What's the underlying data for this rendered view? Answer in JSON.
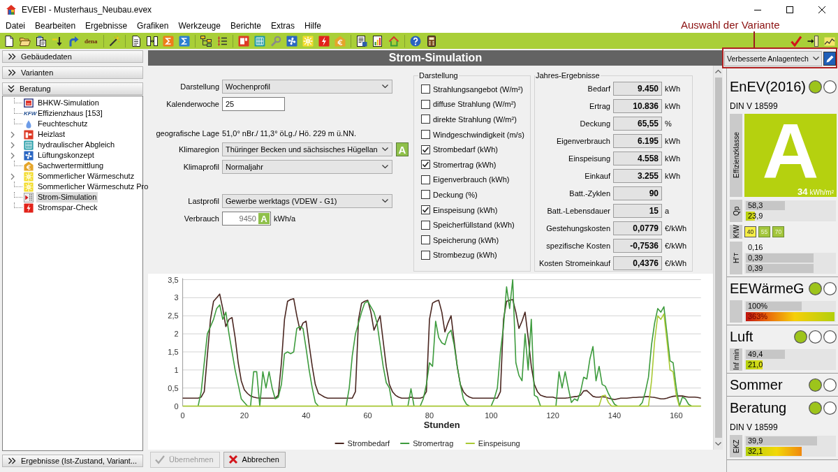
{
  "window": {
    "title": "EVEBI - Musterhaus_Neubau.evex"
  },
  "annotation": {
    "label": "Auswahl der Variante"
  },
  "menu": [
    "Datei",
    "Bearbeiten",
    "Ergebnisse",
    "Grafiken",
    "Werkzeuge",
    "Berichte",
    "Extras",
    "Hilfe"
  ],
  "toolbar": {
    "text_button": "dena"
  },
  "sidebar": {
    "sections": [
      {
        "label": "Gebäudedaten",
        "expanded": false
      },
      {
        "label": "Varianten",
        "expanded": false
      },
      {
        "label": "Beratung",
        "expanded": true,
        "items": [
          {
            "label": "BHKW-Simulation",
            "expandable": false,
            "selected": false
          },
          {
            "label": "Effizienzhaus [153]",
            "logo": "KFW",
            "expandable": false,
            "selected": false
          },
          {
            "label": "Feuchteschutz",
            "expandable": false,
            "selected": false
          },
          {
            "label": "Heizlast",
            "expandable": true,
            "selected": false
          },
          {
            "label": "hydraulischer Abgleich",
            "expandable": true,
            "selected": false
          },
          {
            "label": "Lüftungskonzept",
            "expandable": true,
            "selected": false
          },
          {
            "label": "Sachwertermittlung",
            "expandable": false,
            "selected": false
          },
          {
            "label": "Sommerlicher Wärmeschutz",
            "expandable": true,
            "selected": false
          },
          {
            "label": "Sommerlicher Wärmeschutz Pro",
            "expandable": false,
            "selected": false
          },
          {
            "label": "Strom-Simulation",
            "expandable": false,
            "selected": true
          },
          {
            "label": "Stromspar-Check",
            "expandable": false,
            "selected": false
          }
        ]
      },
      {
        "label": "Ergebnisse (Ist-Zustand, Variant...",
        "expanded": false
      }
    ]
  },
  "panel": {
    "title": "Strom-Simulation",
    "form": [
      [
        {
          "kind": "dropdown",
          "label": "Darstellung",
          "value": "Wochenprofil",
          "disabled": false
        },
        {
          "kind": "input",
          "label": "Kalenderwoche",
          "value": "25",
          "disabled": false
        }
      ],
      [
        {
          "kind": "text",
          "label": "geografische Lage",
          "value": "51,0° nBr./ 11,3° öLg./ Hö. 229 m ü.NN."
        },
        {
          "kind": "dropdown",
          "label": "Klimaregion",
          "value": "Thüringer Becken und sächsisches Hügellan",
          "button": "A",
          "disabled": false
        },
        {
          "kind": "dropdown",
          "label": "Klimaprofil",
          "value": "Normaljahr",
          "disabled": false
        }
      ],
      [
        {
          "kind": "dropdown",
          "label": "Lastprofil",
          "value": "Gewerbe werktags (VDEW - G1)",
          "disabled": false
        },
        {
          "kind": "input",
          "label": "Verbrauch",
          "value": "9450",
          "button": "A",
          "unit": "kWh/a",
          "disabled": true
        }
      ]
    ],
    "display_options": {
      "title": "Darstellung",
      "items": [
        {
          "label": "Strahlungsangebot (W/m²)",
          "checked": false
        },
        {
          "label": "diffuse Strahlung (W/m²)",
          "checked": false
        },
        {
          "label": "direkte Strahlung (W/m²)",
          "checked": false
        },
        {
          "label": "Windgeschwindigkeit (m/s)",
          "checked": false
        },
        {
          "label": "Strombedarf (kWh)",
          "checked": true
        },
        {
          "label": "Stromertrag (kWh)",
          "checked": true
        },
        {
          "label": "Eigenverbrauch (kWh)",
          "checked": false
        },
        {
          "label": "Deckung (%)",
          "checked": false
        },
        {
          "label": "Einspeisung (kWh)",
          "checked": true
        },
        {
          "label": "Speicherfüllstand (kWh)",
          "checked": false
        },
        {
          "label": "Speicherung (kWh)",
          "checked": false
        },
        {
          "label": "Strombezug (kWh)",
          "checked": false
        }
      ]
    },
    "results": {
      "title": "Jahres-Ergebnisse",
      "rows": [
        {
          "label": "Bedarf",
          "value": "9.450",
          "unit": "kWh"
        },
        {
          "label": "Ertrag",
          "value": "10.836",
          "unit": "kWh"
        },
        {
          "label": "Deckung",
          "value": "65,55",
          "unit": "%"
        },
        {
          "label": "Eigenverbrauch",
          "value": "6.195",
          "unit": "kWh"
        },
        {
          "label": "Einspeisung",
          "value": "4.558",
          "unit": "kWh"
        },
        {
          "label": "Einkauf",
          "value": "3.255",
          "unit": "kWh"
        },
        {
          "label": "Batt.-Zyklen",
          "value": "90"
        },
        {
          "label": "Batt.-Lebensdauer",
          "value": "15",
          "unit": "a"
        },
        {
          "label": "Gestehungskosten",
          "value": "0,0779",
          "unit": "€/kWh"
        },
        {
          "label": "spezifische Kosten",
          "value": "-0,7536",
          "unit": "€/kWh"
        },
        {
          "label": "Kosten Stromeinkauf",
          "value": "0,4376",
          "unit": "€/kWh"
        }
      ]
    },
    "chart_data": {
      "type": "line",
      "xlabel": "Stunden",
      "grid": true,
      "legend": true,
      "xlim": [
        0,
        168
      ],
      "ylim": [
        0,
        3.5
      ],
      "xticks": [
        0,
        20,
        40,
        60,
        80,
        100,
        120,
        140,
        160
      ],
      "yticks": [
        0,
        {
          "value": 0.5,
          "label": "0,5"
        },
        1,
        {
          "value": 1.5,
          "label": "1,5"
        },
        2,
        {
          "value": 2.5,
          "label": "2,5"
        },
        3,
        {
          "value": 3.5,
          "label": "3,5"
        }
      ],
      "x": [
        0,
        1,
        2,
        3,
        4,
        5,
        6,
        7,
        8,
        9,
        10,
        11,
        12,
        13,
        14,
        15,
        16,
        17,
        18,
        19,
        20,
        21,
        22,
        23,
        24,
        25,
        26,
        27,
        28,
        29,
        30,
        31,
        32,
        33,
        34,
        35,
        36,
        37,
        38,
        39,
        40,
        41,
        42,
        43,
        44,
        45,
        46,
        47,
        48,
        49,
        50,
        51,
        52,
        53,
        54,
        55,
        56,
        57,
        58,
        59,
        60,
        61,
        62,
        63,
        64,
        65,
        66,
        67,
        68,
        69,
        70,
        71,
        72,
        73,
        74,
        75,
        76,
        77,
        78,
        79,
        80,
        81,
        82,
        83,
        84,
        85,
        86,
        87,
        88,
        89,
        90,
        91,
        92,
        93,
        94,
        95,
        96,
        97,
        98,
        99,
        100,
        101,
        102,
        103,
        104,
        105,
        106,
        107,
        108,
        109,
        110,
        111,
        112,
        113,
        114,
        115,
        116,
        117,
        118,
        119,
        120,
        121,
        122,
        123,
        124,
        125,
        126,
        127,
        128,
        129,
        130,
        131,
        132,
        133,
        134,
        135,
        136,
        137,
        138,
        139,
        140,
        141,
        142,
        143,
        144,
        145,
        146,
        147,
        148,
        149,
        150,
        151,
        152,
        153,
        154,
        155,
        156,
        157,
        158,
        159,
        160,
        161,
        162,
        163,
        164,
        165,
        166,
        167,
        168
      ],
      "series": [
        {
          "name": "Strombedarf",
          "color": "#4a2620",
          "values": [
            0.22,
            0.22,
            0.22,
            0.22,
            0.22,
            0.22,
            0.25,
            0.4,
            1.4,
            2.4,
            2.9,
            3.0,
            3.1,
            2.7,
            2.2,
            2.4,
            2.45,
            1.9,
            1.2,
            0.7,
            0.45,
            0.35,
            0.28,
            0.25,
            0.23,
            0.22,
            0.22,
            0.22,
            0.22,
            0.22,
            0.22,
            0.3,
            1.2,
            2.4,
            2.9,
            2.95,
            2.97,
            2.5,
            2.1,
            2.3,
            2.35,
            1.7,
            1.1,
            0.6,
            0.35,
            0.3,
            0.25,
            0.22,
            0.22,
            0.22,
            0.22,
            0.22,
            0.22,
            0.22,
            0.22,
            0.22,
            0.4,
            2.4,
            2.85,
            2.9,
            2.93,
            2.6,
            2.1,
            2.3,
            2.5,
            1.8,
            1.1,
            0.6,
            0.4,
            0.3,
            0.25,
            0.22,
            0.22,
            0.22,
            0.25,
            0.22,
            0.22,
            0.22,
            0.25,
            0.4,
            2.4,
            2.85,
            2.9,
            2.93,
            2.6,
            2.05,
            2.3,
            2.5,
            1.8,
            1.1,
            0.6,
            0.4,
            0.3,
            0.25,
            0.22,
            0.22,
            0.22,
            0.22,
            0.22,
            0.22,
            0.22,
            0.22,
            0.22,
            0.4,
            2.4,
            2.9,
            2.93,
            2.95,
            2.6,
            2.15,
            2.35,
            2.6,
            1.9,
            1.1,
            0.6,
            0.4,
            0.3,
            0.27,
            0.25,
            0.25,
            0.25,
            0.22,
            0.22,
            0.22,
            0.22,
            0.23,
            0.25,
            0.26,
            0.27,
            0.3,
            0.42,
            0.43,
            0.35,
            0.27,
            0.25,
            0.25,
            0.26,
            0.25,
            0.22,
            0.2,
            0.18,
            0.2,
            0.22,
            0.22,
            0.22,
            0.23,
            0.24,
            0.24,
            0.25,
            0.25,
            0.26,
            0.26,
            0.25,
            0.24,
            0.22,
            0.2,
            0.2,
            0.22,
            0.25,
            0.27,
            0.28,
            0.28,
            0.28,
            0.26,
            0.25,
            0.25,
            0.25,
            0.24,
            0.22
          ]
        },
        {
          "name": "Stromertrag",
          "color": "#3d9b3d",
          "values": [
            null,
            null,
            null,
            null,
            null,
            0,
            0.4,
            1.2,
            2.0,
            2.2,
            2.4,
            2.7,
            2.8,
            2.4,
            2.6,
            2.0,
            1.5,
            1.0,
            0.6,
            0.2,
            0.1,
            0,
            0,
            0.95,
            0.95,
            0,
            0.95,
            0.5,
            0.95,
            0.5,
            0.2,
            0.25,
            0.6,
            1.45,
            1.5,
            1.45,
            1.5,
            2.15,
            2.2,
            2.15,
            1.6,
            1.0,
            0.5,
            0.1,
            0,
            null,
            null,
            null,
            null,
            null,
            null,
            null,
            null,
            0,
            0.5,
            1.4,
            2.0,
            2.3,
            2.6,
            2.85,
            2.9,
            2.75,
            2.6,
            2.3,
            1.7,
            1.1,
            0.65,
            0.5,
            0,
            null,
            null,
            null,
            null,
            0,
            0.48,
            0,
            null,
            0,
            0.2,
            0.6,
            1.2,
            1.1,
            2.35,
            1.9,
            1.75,
            1.7,
            2.0,
            2.1,
            1.7,
            1.1,
            0.6,
            0.2,
            0.05,
            0,
            null,
            null,
            null,
            null,
            null,
            null,
            0,
            0.2,
            0.5,
            1.5,
            2.2,
            3.3,
            2.7,
            3.5,
            1.2,
            0.85,
            0.7,
            2.0,
            1.0,
            2.4,
            0.3,
            0.25,
            0,
            null,
            null,
            null,
            null,
            0,
            0.95,
            0.5,
            0.95,
            0.5,
            0.1,
            0.2,
            0.15,
            0.4,
            0.8,
            0.75,
            1.3,
            1.65,
            0.7,
            1.1,
            0.6,
            0.55,
            0.35,
            0.2,
            0.05,
            0,
            null,
            null,
            null,
            null,
            null,
            null,
            0,
            0.1,
            0.4,
            0.8,
            1.7,
            2.3,
            2.7,
            2.6,
            2.75,
            2.0,
            1.25,
            1.2,
            0.5,
            0,
            0.25,
            0.2,
            0.05,
            0,
            null,
            null,
            null
          ]
        },
        {
          "name": "Einspeisung",
          "color": "#a9c934",
          "values": [
            0,
            0,
            0,
            0,
            0,
            0,
            0,
            0,
            0,
            0,
            0,
            0,
            0,
            0,
            0,
            0,
            0,
            0,
            0,
            0,
            0,
            0,
            0,
            0,
            0,
            0,
            0,
            0,
            0,
            0,
            0,
            0,
            0,
            0,
            0,
            0,
            0,
            0,
            0,
            0,
            0,
            0,
            0,
            0,
            0,
            0,
            0,
            0,
            0,
            0,
            0,
            0,
            0,
            0,
            0,
            0,
            0,
            0,
            0,
            0,
            0,
            0,
            0,
            0,
            0,
            0,
            0,
            0,
            0,
            0,
            0,
            0,
            0,
            0,
            0,
            0,
            0,
            0,
            0,
            0,
            0,
            0,
            0,
            0,
            0,
            0,
            0,
            0,
            0,
            0,
            0,
            0,
            0,
            0,
            0,
            0,
            0,
            0,
            0,
            0,
            0,
            0,
            0,
            0,
            0,
            0,
            0,
            0,
            0,
            0,
            0,
            0,
            0,
            0,
            0,
            0,
            0,
            0,
            0,
            0,
            0,
            0,
            0,
            0,
            0,
            0,
            0,
            0,
            0,
            0,
            0,
            0,
            0,
            0,
            0,
            0,
            0.28,
            0.3,
            0.1,
            0,
            0,
            0,
            0,
            0,
            0,
            0,
            0,
            0,
            0,
            0,
            0,
            0,
            0.7,
            1.8,
            2.5,
            2.4,
            2.55,
            1.8,
            1.0,
            0.95,
            0.3,
            0,
            0,
            0,
            0,
            0,
            0,
            0,
            0
          ]
        }
      ]
    },
    "buttons": [
      {
        "kind": "apply",
        "label": "Übernehmen",
        "disabled": true
      },
      {
        "kind": "cancel",
        "label": "Abbrechen",
        "disabled": false
      }
    ]
  },
  "variant_selector": {
    "value": "Verbesserte Anlagentech"
  },
  "ratings": [
    {
      "title": "EnEV(2016)",
      "subtitle": "DIN V 18599",
      "lights": [
        {
          "on": true
        },
        {
          "on": false
        }
      ],
      "efficiency": {
        "label": "Effizienzklasse",
        "class": "A",
        "value": "34",
        "unit": "kWh/m²"
      },
      "metrics": [
        {
          "kind": "bars",
          "label": "Qp",
          "bars": [
            {
              "kind": "reference",
              "text": "58,3",
              "level": 0.44
            },
            {
              "kind": "result",
              "text": "23,9",
              "level": 0.1
            }
          ]
        },
        {
          "kind": "classes",
          "label": "KfW",
          "classes": [
            {
              "text": "40",
              "selected": true
            },
            {
              "text": "55",
              "selected": false
            },
            {
              "text": "70",
              "selected": false
            }
          ]
        },
        {
          "kind": "bars",
          "label": "H'$_{T}$",
          "bars": [
            {
              "kind": "text",
              "text": "0,16"
            },
            {
              "kind": "reference",
              "text": "0,39",
              "level": 0.76
            },
            {
              "kind": "reference",
              "text": "0,39",
              "level": 0.76
            }
          ]
        }
      ]
    },
    {
      "title": "EEWärmeG",
      "lights": [
        {
          "on": true
        },
        {
          "on": false
        }
      ],
      "metrics": [
        {
          "kind": "bars",
          "bars": [
            {
              "kind": "reference",
              "text": "100%",
              "level": 0.63
            },
            {
              "kind": "heat-scale",
              "text": "363%",
              "level": 1
            }
          ]
        }
      ]
    },
    {
      "title": "Luft",
      "lights": [
        {
          "on": true
        },
        {
          "on": false
        },
        {
          "on": false
        }
      ],
      "metrics": [
        {
          "kind": "bars",
          "label": "Inf min",
          "bars": [
            {
              "kind": "reference",
              "text": "49,4",
              "level": 0.44
            },
            {
              "kind": "result",
              "text": "21,0",
              "level": 0.19
            }
          ]
        }
      ]
    },
    {
      "title": "Sommer",
      "lights": [
        {
          "on": true
        },
        {
          "on": false
        }
      ]
    },
    {
      "title": "Beratung",
      "subtitle": "DIN V 18599",
      "lights": [
        {
          "on": true
        },
        {
          "on": false
        }
      ],
      "metrics": [
        {
          "kind": "bars",
          "label": "EKZ",
          "bars": [
            {
              "kind": "reference",
              "text": "39,9",
              "level": 0.8
            },
            {
              "kind": "energy-scale",
              "text": "32,1",
              "level": 0.63
            }
          ]
        }
      ]
    }
  ]
}
